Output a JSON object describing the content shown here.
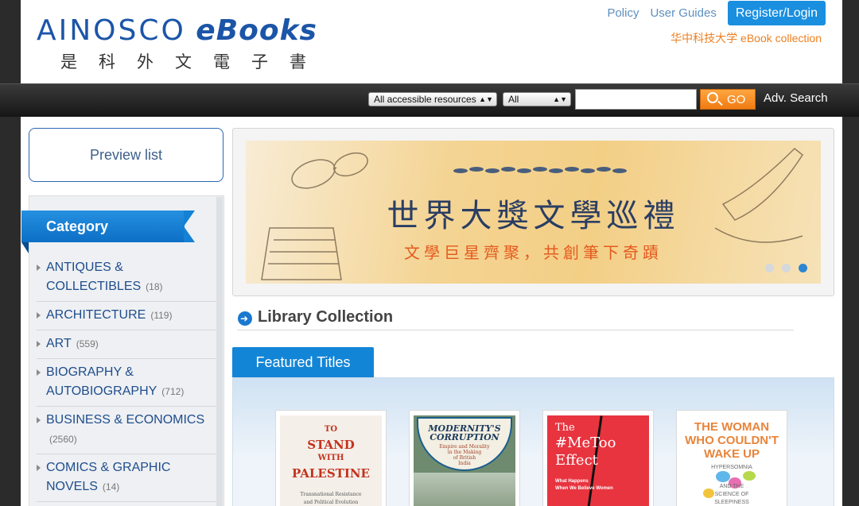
{
  "header": {
    "logo_main_a": "AINOSCO",
    "logo_main_b": "eBooks",
    "logo_sub": "是科外文電子書",
    "links": [
      "Policy",
      "User Guides"
    ],
    "login_label": "Register/Login",
    "collection_note": "华中科技大学 eBook collection"
  },
  "search": {
    "scope_value": "All accessible resources",
    "field_value": "All",
    "query_value": "",
    "go_label": "GO",
    "advanced_label": "Adv. Search"
  },
  "sidebar": {
    "preview_label": "Preview list",
    "category_title": "Category",
    "categories": [
      {
        "line1": "ANTIQUES &",
        "line2": "COLLECTIBLES",
        "count": "(18)"
      },
      {
        "line1": "ARCHITECTURE",
        "count": "(119)"
      },
      {
        "line1": "ART",
        "count": "(559)"
      },
      {
        "line1": "BIOGRAPHY &",
        "line2": "AUTOBIOGRAPHY",
        "count": "(712)"
      },
      {
        "line1": "BUSINESS & ECONOMICS",
        "count": "(2560)"
      },
      {
        "line1": "COMICS & GRAPHIC",
        "line2": "NOVELS",
        "count": "(14)"
      }
    ]
  },
  "banner": {
    "title": "世界大獎文學巡禮",
    "subtitle": "文學巨星齊聚，共創筆下奇蹟",
    "slide_count": 3,
    "active_slide": 3
  },
  "library": {
    "title": "Library Collection",
    "featured_tab": "Featured Titles"
  },
  "books": [
    {
      "l1": "TO",
      "l2": "STAND",
      "l3": "WITH",
      "l4": "PALESTINE",
      "l5": "Transnational Resistance",
      "l6": "and Political Evolution"
    },
    {
      "l1": "MODERNITY'S",
      "l2": "CORRUPTION",
      "l3": "Empire and Morality",
      "l4": "in the Making",
      "l5": "of British",
      "l6": "India"
    },
    {
      "l1": "The",
      "l2": "#MeToo",
      "l3": "Effect",
      "l4": "What Happens",
      "l5": "When We Believe Women"
    },
    {
      "l1": "THE WOMAN",
      "l2": "WHO COULDN'T",
      "l3": "WAKE UP",
      "l4": "HYPERSOMNIA",
      "l5": "AND THE",
      "l6": "SCIENCE OF",
      "l7": "SLEEPINESS"
    }
  ],
  "colors": {
    "brand_blue": "#1b55a8",
    "accent_orange": "#ee8022",
    "tab_blue": "#1385d6"
  }
}
